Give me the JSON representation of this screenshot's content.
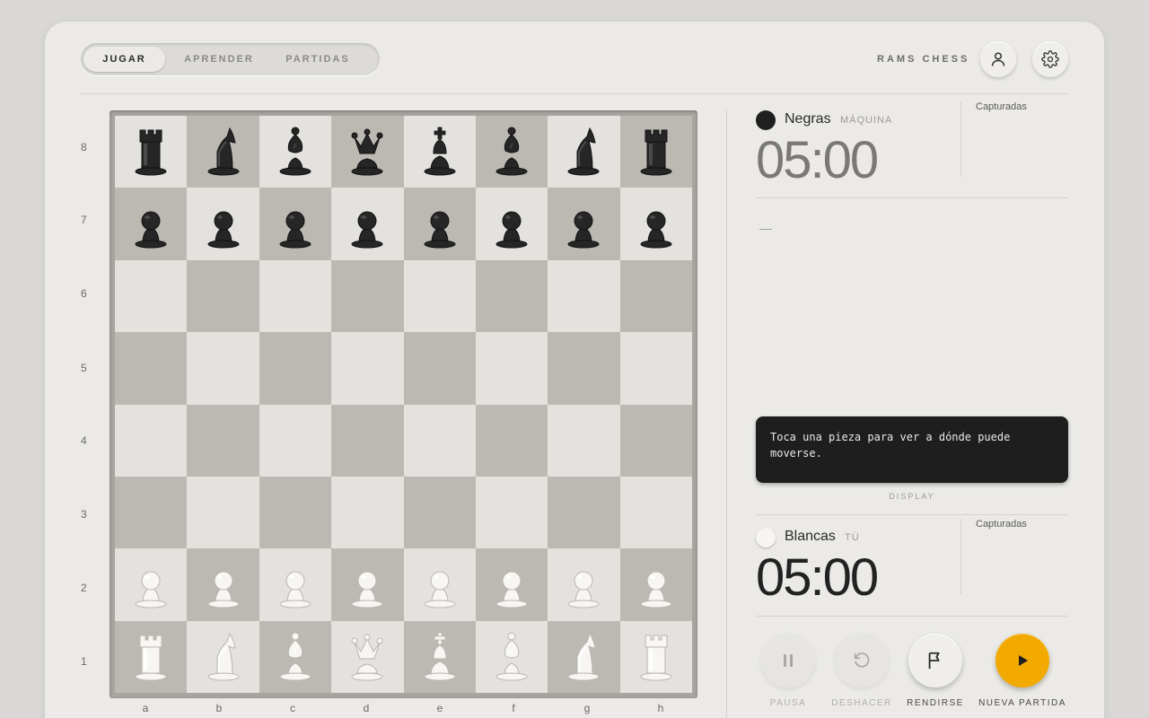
{
  "tabs": [
    {
      "label": "JUGAR",
      "active": true
    },
    {
      "label": "APRENDER",
      "active": false
    },
    {
      "label": "PARTIDAS",
      "active": false
    }
  ],
  "brand": "RAMS CHESS",
  "header_icons": [
    "user-icon",
    "gear-icon"
  ],
  "board": {
    "ranks": [
      "8",
      "7",
      "6",
      "5",
      "4",
      "3",
      "2",
      "1"
    ],
    "files": [
      "a",
      "b",
      "c",
      "d",
      "e",
      "f",
      "g",
      "h"
    ],
    "position": [
      [
        "r",
        "n",
        "b",
        "q",
        "k",
        "b",
        "n",
        "r"
      ],
      [
        "p",
        "p",
        "p",
        "p",
        "p",
        "p",
        "p",
        "p"
      ],
      [
        "",
        "",
        "",
        "",
        "",
        "",
        "",
        ""
      ],
      [
        "",
        "",
        "",
        "",
        "",
        "",
        "",
        ""
      ],
      [
        "",
        "",
        "",
        "",
        "",
        "",
        "",
        ""
      ],
      [
        "",
        "",
        "",
        "",
        "",
        "",
        "",
        ""
      ],
      [
        "P",
        "P",
        "P",
        "P",
        "P",
        "P",
        "P",
        "P"
      ],
      [
        "R",
        "N",
        "B",
        "Q",
        "K",
        "B",
        "N",
        "R"
      ]
    ],
    "colors": {
      "light": "#e3e2df",
      "dark": "#bcb9b3"
    }
  },
  "black": {
    "name": "Negras",
    "role": "MÁQUINA",
    "clock": "05:00",
    "captured_label": "Capturadas",
    "clock_color": "#7a7976"
  },
  "white": {
    "name": "Blancas",
    "role": "TÚ",
    "clock": "05:00",
    "captured_label": "Capturadas",
    "clock_color": "#222222"
  },
  "move_log": "—",
  "display": {
    "text": "Toca una pieza para ver a dónde puede moverse.",
    "label": "DISPLAY"
  },
  "controls": {
    "pause": {
      "label": "PAUSA",
      "enabled": false
    },
    "undo": {
      "label": "DESHACER",
      "enabled": false
    },
    "resign": {
      "label": "RENDIRSE",
      "enabled": true
    },
    "new_game": {
      "label": "NUEVA PARTIDA",
      "enabled": true
    }
  },
  "accent_color": "#f2a900"
}
